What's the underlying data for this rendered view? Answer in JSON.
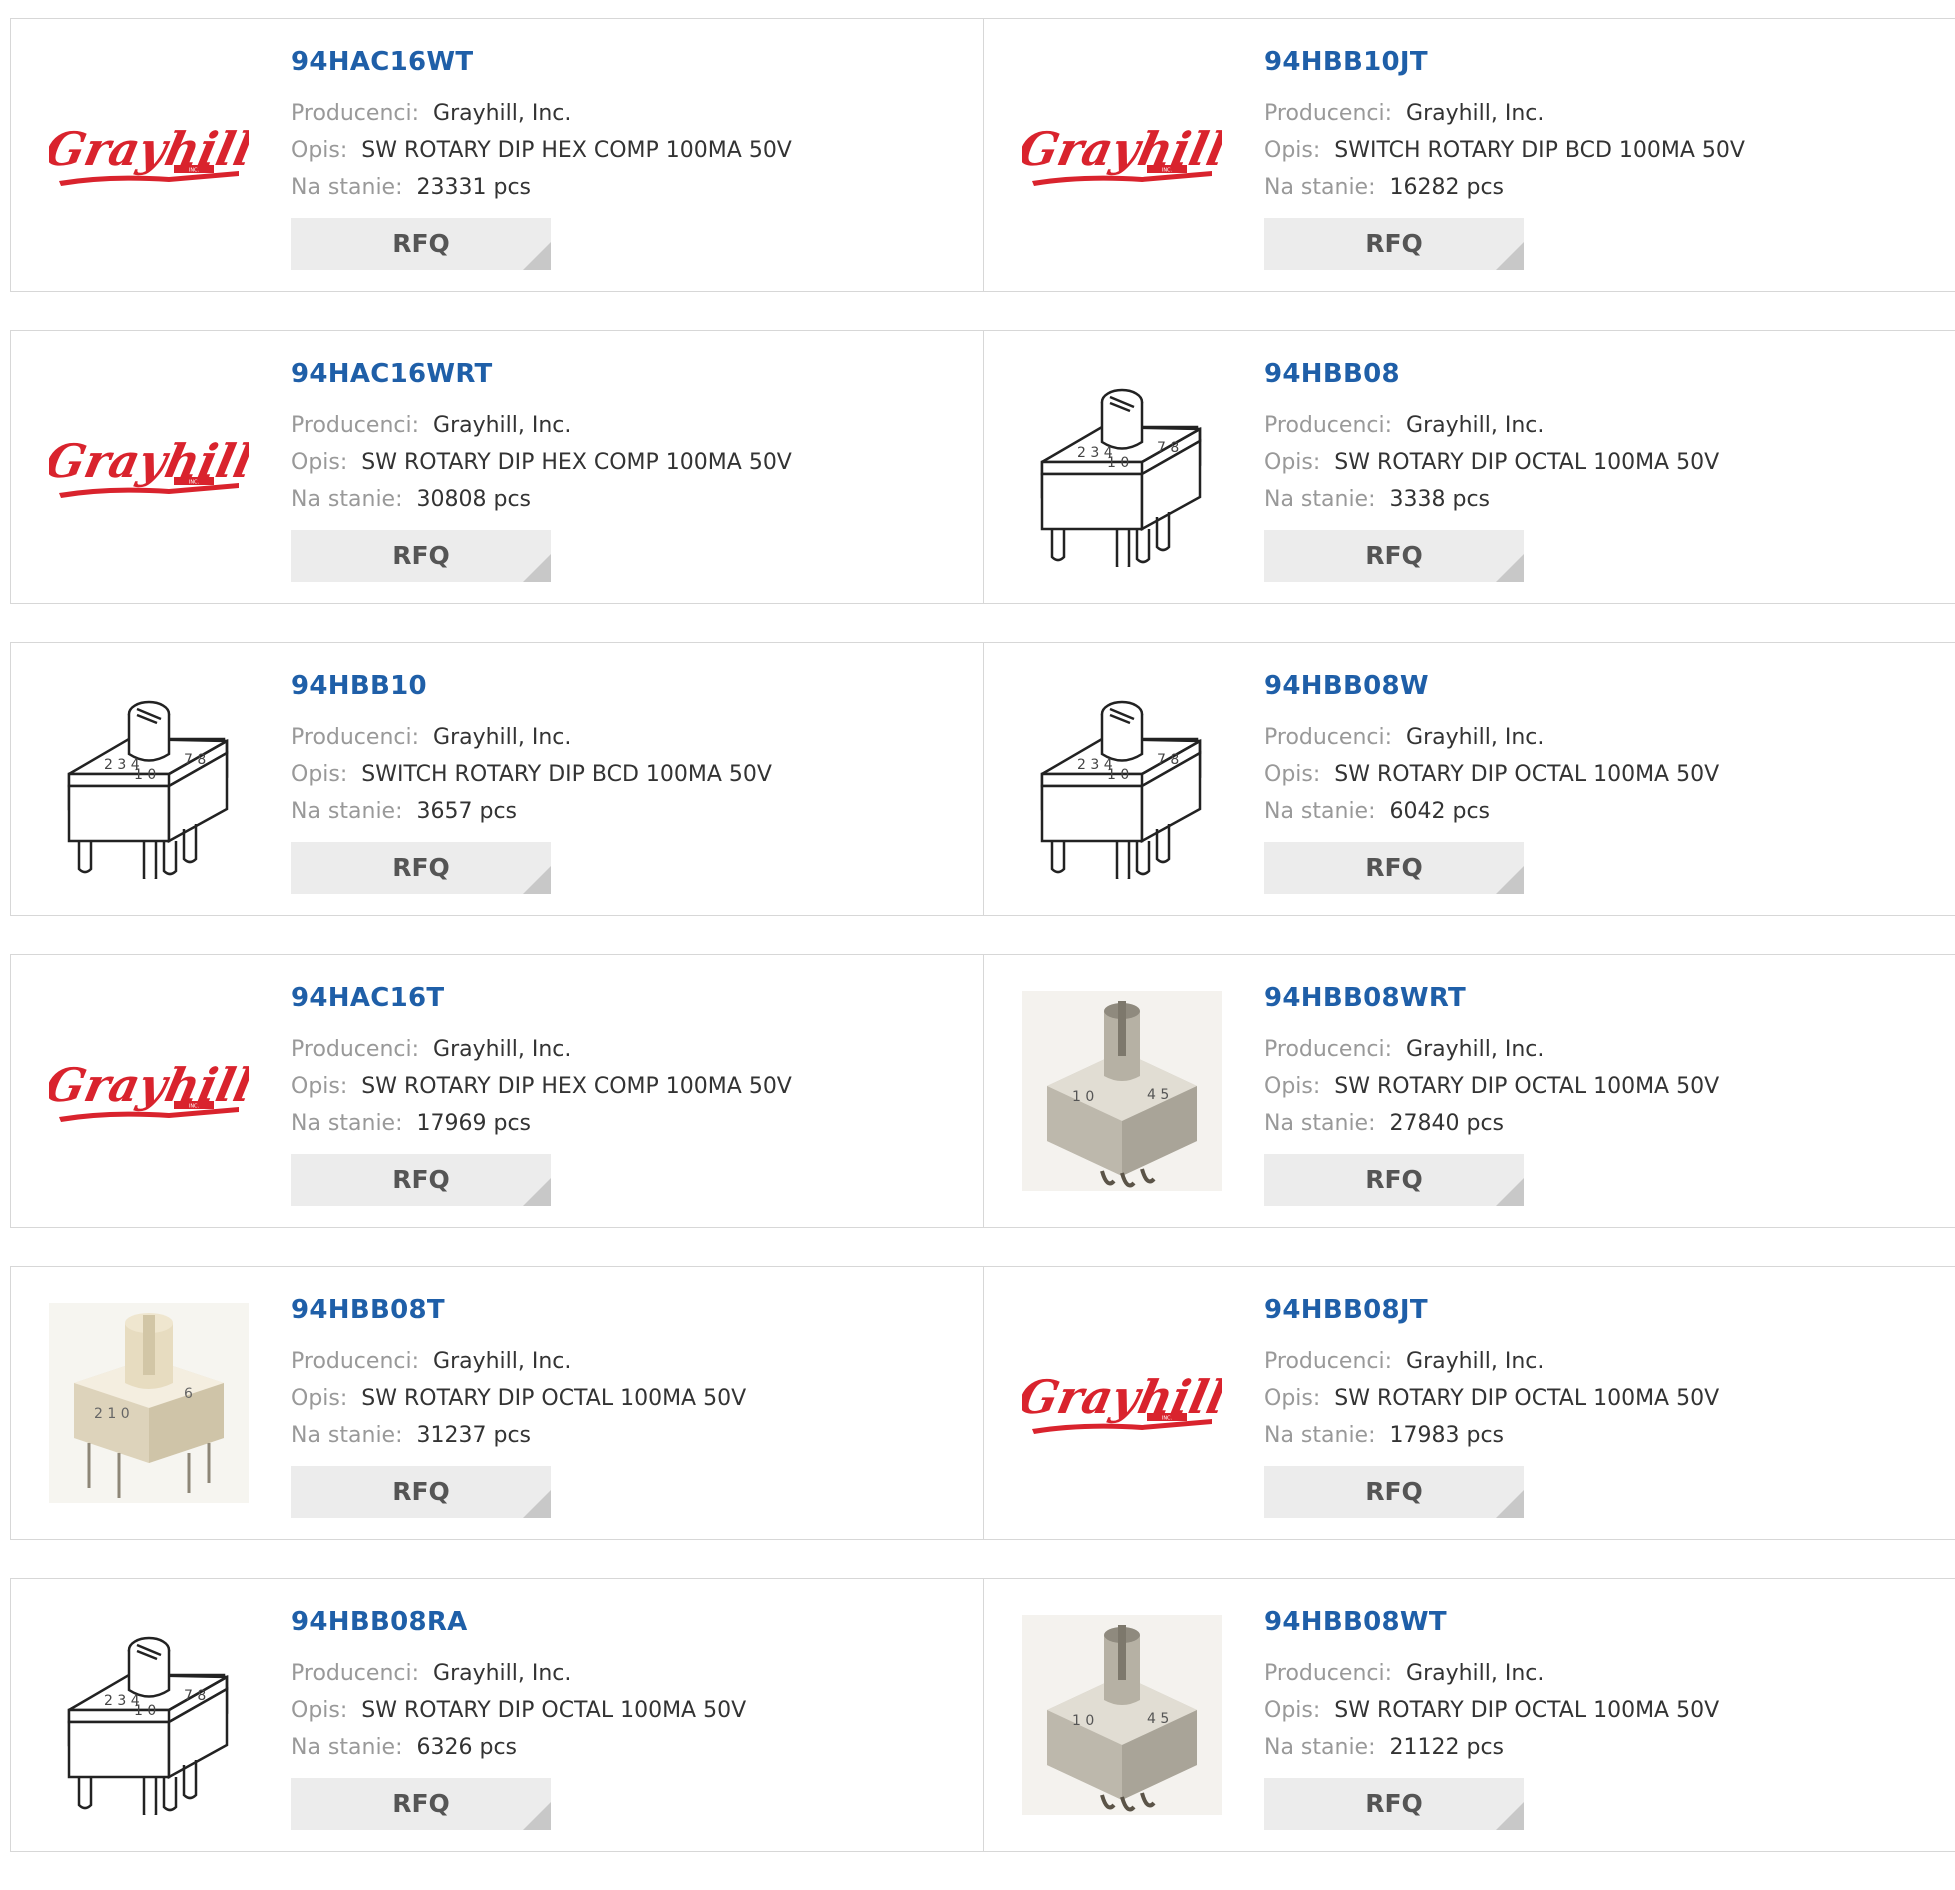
{
  "labels": {
    "manufacturer": "Producenci:",
    "description": "Opis:",
    "stock": "Na stanie:",
    "rfq": "RFQ"
  },
  "products": [
    {
      "part": "94HAC16WT",
      "manufacturer": "Grayhill, Inc.",
      "description": "SW ROTARY DIP HEX COMP 100MA 50V",
      "stock": "23331 pcs",
      "image": "grayhill-logo",
      "logo_text": "Grayhill",
      "logo_sub": "INC."
    },
    {
      "part": "94HBB10JT",
      "manufacturer": "Grayhill, Inc.",
      "description": "SWITCH ROTARY DIP BCD 100MA 50V",
      "stock": "16282 pcs",
      "image": "grayhill-logo",
      "logo_text": "Grayhill",
      "logo_sub": "INC."
    },
    {
      "part": "94HAC16WRT",
      "manufacturer": "Grayhill, Inc.",
      "description": "SW ROTARY DIP HEX COMP 100MA 50V",
      "stock": "30808 pcs",
      "image": "grayhill-logo",
      "logo_text": "Grayhill",
      "logo_sub": "INC."
    },
    {
      "part": "94HBB08",
      "manufacturer": "Grayhill, Inc.",
      "description": "SW ROTARY DIP OCTAL 100MA 50V",
      "stock": "3338 pcs",
      "image": "rotary-switch-drawing"
    },
    {
      "part": "94HBB10",
      "manufacturer": "Grayhill, Inc.",
      "description": "SWITCH ROTARY DIP BCD 100MA 50V",
      "stock": "3657 pcs",
      "image": "rotary-switch-drawing"
    },
    {
      "part": "94HBB08W",
      "manufacturer": "Grayhill, Inc.",
      "description": "SW ROTARY DIP OCTAL 100MA 50V",
      "stock": "6042 pcs",
      "image": "rotary-switch-drawing"
    },
    {
      "part": "94HAC16T",
      "manufacturer": "Grayhill, Inc.",
      "description": "SW ROTARY DIP HEX COMP 100MA 50V",
      "stock": "17969 pcs",
      "image": "grayhill-logo",
      "logo_text": "Grayhill",
      "logo_sub": "INC."
    },
    {
      "part": "94HBB08WRT",
      "manufacturer": "Grayhill, Inc.",
      "description": "SW ROTARY DIP OCTAL 100MA 50V",
      "stock": "27840 pcs",
      "image": "rotary-switch-photo-gray"
    },
    {
      "part": "94HBB08T",
      "manufacturer": "Grayhill, Inc.",
      "description": "SW ROTARY DIP OCTAL 100MA 50V",
      "stock": "31237 pcs",
      "image": "rotary-switch-photo-cream"
    },
    {
      "part": "94HBB08JT",
      "manufacturer": "Grayhill, Inc.",
      "description": "SW ROTARY DIP OCTAL 100MA 50V",
      "stock": "17983 pcs",
      "image": "grayhill-logo",
      "logo_text": "Grayhill",
      "logo_sub": "INC."
    },
    {
      "part": "94HBB08RA",
      "manufacturer": "Grayhill, Inc.",
      "description": "SW ROTARY DIP OCTAL 100MA 50V",
      "stock": "6326 pcs",
      "image": "rotary-switch-drawing"
    },
    {
      "part": "94HBB08WT",
      "manufacturer": "Grayhill, Inc.",
      "description": "SW ROTARY DIP OCTAL 100MA 50V",
      "stock": "21122 pcs",
      "image": "rotary-switch-photo-gray"
    }
  ],
  "colors": {
    "part_link": "#1f5fa8",
    "label": "#999999",
    "value": "#333333",
    "rfq_bg": "#ececec",
    "logo_red": "#d9232d"
  }
}
